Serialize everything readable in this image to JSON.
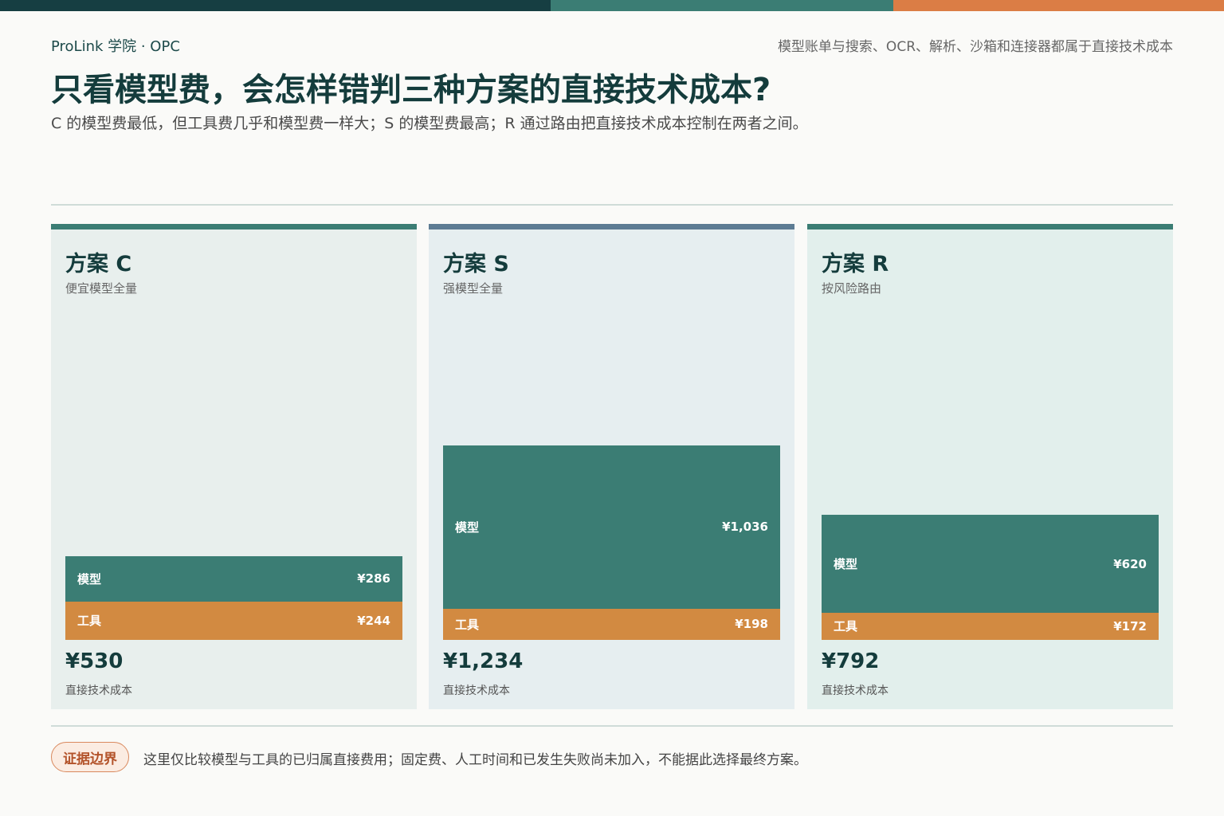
{
  "colors": {
    "topbar": [
      "#163e42",
      "#3b7d74",
      "#db7d45"
    ],
    "model": "#3b7d74",
    "tool": "#d28a41",
    "card_accent": [
      "#3b7d74",
      "#5d7c94",
      "#3b7d74"
    ],
    "card_bg": [
      "#e8efed",
      "#e6eef0",
      "#e2efec"
    ]
  },
  "header": {
    "brand": "ProLink 学院 · OPC",
    "note": "模型账单与搜索、OCR、解析、沙箱和连接器都属于直接技术成本",
    "title": "只看模型费，会怎样错判三种方案的直接技术成本?",
    "subtitle": "C 的模型费最低，但工具费几乎和模型费一样大；S 的模型费最高；R 通过路由把直接技术成本控制在两者之间。"
  },
  "cards": [
    {
      "title": "方案 C",
      "subtitle": "便宜模型全量",
      "model_label": "模型",
      "model_value": "¥286",
      "tool_label": "工具",
      "tool_value": "¥244",
      "total": "¥530",
      "total_label": "直接技术成本"
    },
    {
      "title": "方案 S",
      "subtitle": "强模型全量",
      "model_label": "模型",
      "model_value": "¥1,036",
      "tool_label": "工具",
      "tool_value": "¥198",
      "total": "¥1,234",
      "total_label": "直接技术成本"
    },
    {
      "title": "方案 R",
      "subtitle": "按风险路由",
      "model_label": "模型",
      "model_value": "¥620",
      "tool_label": "工具",
      "tool_value": "¥172",
      "total": "¥792",
      "total_label": "直接技术成本"
    }
  ],
  "chart_data": {
    "type": "bar",
    "stacked": true,
    "categories": [
      "方案 C",
      "方案 S",
      "方案 R"
    ],
    "series": [
      {
        "name": "模型",
        "values": [
          286,
          1036,
          620
        ]
      },
      {
        "name": "工具",
        "values": [
          244,
          198,
          172
        ]
      }
    ],
    "totals": [
      530,
      1234,
      792
    ]
  },
  "footer": {
    "badge": "证据边界",
    "text": "这里仅比较模型与工具的已归属直接费用；固定费、人工时间和已发生失败尚未加入，不能据此选择最终方案。"
  }
}
